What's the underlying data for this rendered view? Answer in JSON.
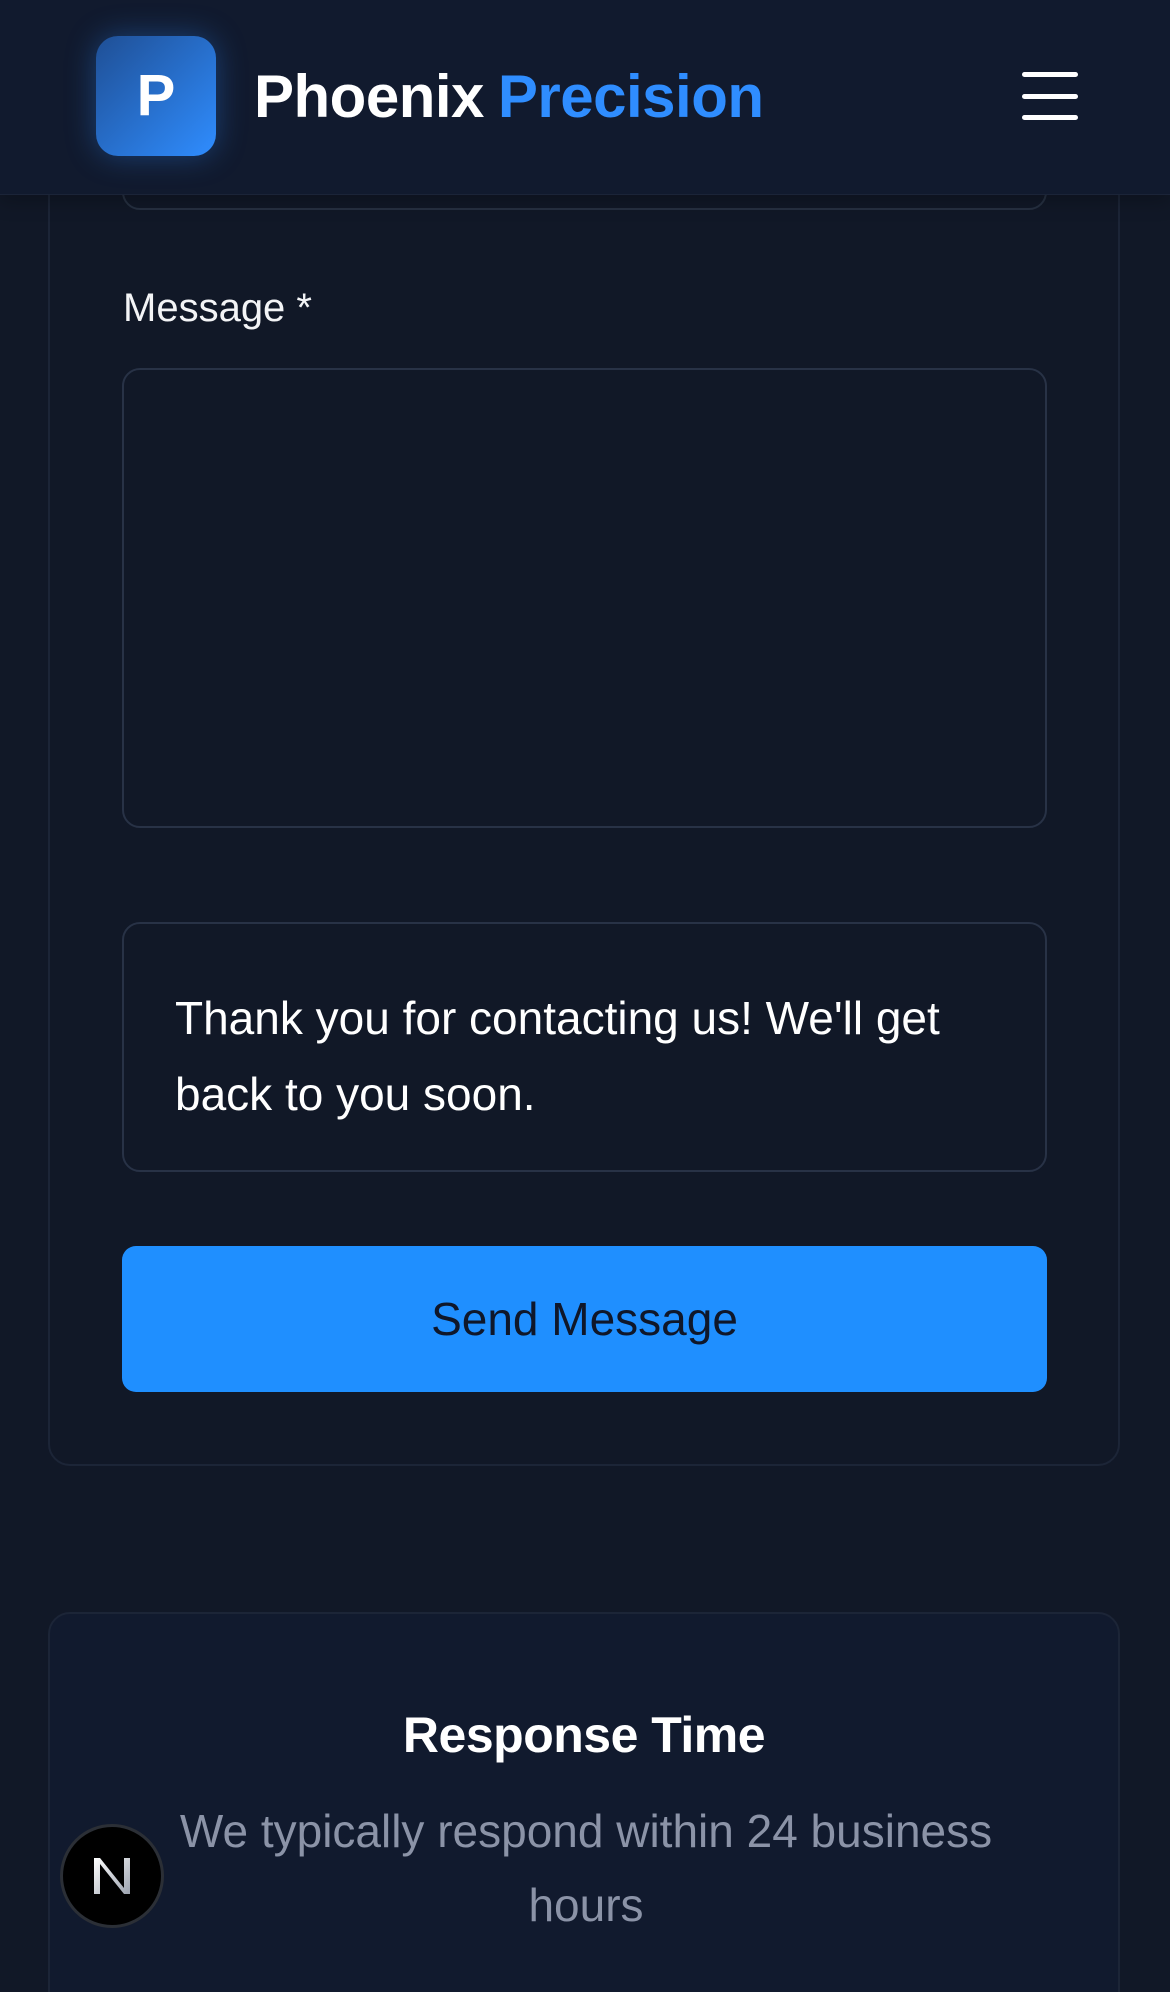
{
  "header": {
    "logo_letter": "P",
    "brand_primary": "Phoenix",
    "brand_accent": "Precision",
    "menu_icon": "hamburger-menu-icon"
  },
  "form": {
    "message_label": "Message *",
    "message_value": "",
    "confirmation_text": "Thank you for contacting us! We'll get back to you soon.",
    "submit_label": "Send Message"
  },
  "response_card": {
    "title": "Response Time",
    "text": "We typically respond within 24 business hours"
  },
  "floating_badge": {
    "letter": "N",
    "icon": "next-logo-icon"
  },
  "colors": {
    "background": "#111827",
    "accent": "#1f8fff",
    "muted_text": "#8b93a7"
  }
}
